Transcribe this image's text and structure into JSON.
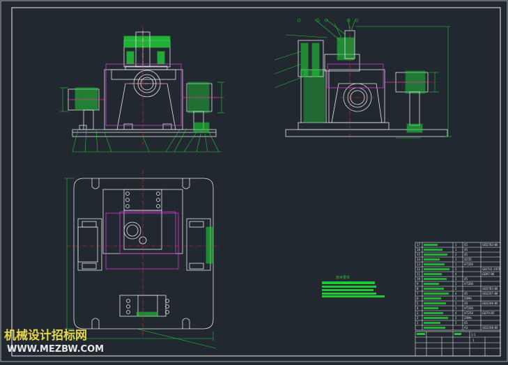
{
  "drawing": {
    "title": "",
    "note_title": "技术要求",
    "dimension_texts": {
      "front_view_bottom": [],
      "side_view_height": "",
      "plan_width": "",
      "plan_height": ""
    },
    "colors": {
      "background": "#212830",
      "outline": "#e8e8e8",
      "center_line": "#e23333",
      "dimension": "#22c838",
      "hatch": "#22c838",
      "hidden_part": "#d63ad6",
      "leader": "#22c838",
      "border": "#ffffff"
    }
  },
  "bom": {
    "rows": [
      {
        "no": "17",
        "name": "",
        "qty": "1",
        "material": "45",
        "std": "GB5782-86"
      },
      {
        "no": "16",
        "name": "",
        "qty": "1",
        "material": "45",
        "std": ""
      },
      {
        "no": "15",
        "name": "",
        "qty": "2",
        "material": "45",
        "std": ""
      },
      {
        "no": "14",
        "name": "",
        "qty": "1",
        "material": "Q235",
        "std": ""
      },
      {
        "no": "13",
        "name": "",
        "qty": "1",
        "material": "HT200",
        "std": ""
      },
      {
        "no": "12",
        "name": "",
        "qty": "2",
        "material": "",
        "std": "GB/T41-1976"
      },
      {
        "no": "11",
        "name": "",
        "qty": "4",
        "material": "",
        "std": "GB97-86"
      },
      {
        "no": "10",
        "name": "",
        "qty": "2",
        "material": "45",
        "std": ""
      },
      {
        "no": "9",
        "name": "",
        "qty": "1",
        "material": "HT200",
        "std": ""
      },
      {
        "no": "8",
        "name": "",
        "qty": "2",
        "material": "",
        "std": "GB5783-86"
      },
      {
        "no": "7",
        "name": "",
        "qty": "4",
        "material": "45",
        "std": "GB2207-86"
      },
      {
        "no": "6",
        "name": "",
        "qty": "1",
        "material": "20Mn",
        "std": ""
      },
      {
        "no": "5",
        "name": "",
        "qty": "2",
        "material": "20",
        "std": "GB2206-80"
      },
      {
        "no": "4",
        "name": "",
        "qty": "1",
        "material": "HT200",
        "std": ""
      },
      {
        "no": "3",
        "name": "",
        "qty": "4",
        "material": "HT250",
        "std": "GB70-85"
      },
      {
        "no": "2",
        "name": "",
        "qty": "2",
        "material": "20Mn",
        "std": ""
      },
      {
        "no": "1",
        "name": "",
        "qty": "1",
        "material": "45",
        "std": ""
      },
      {
        "no": "",
        "name": "",
        "qty": "",
        "material": "A3",
        "std": "GB2208-80"
      }
    ],
    "title_block": {
      "scale": "1:1",
      "sheet": "1"
    }
  },
  "watermark": {
    "line1": "机械设计招标网",
    "line2": "WWW.MEZBW.COM"
  }
}
